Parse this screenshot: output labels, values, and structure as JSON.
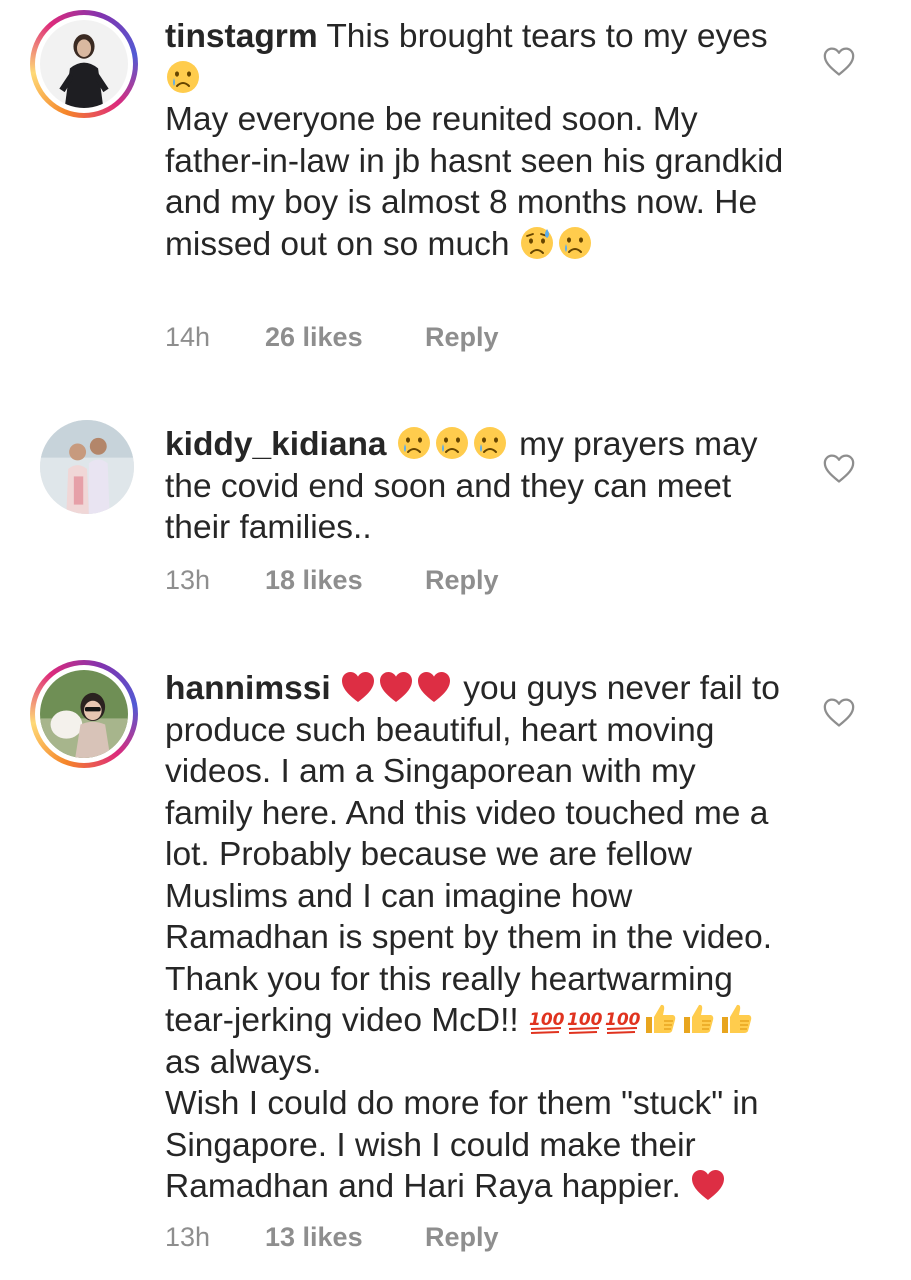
{
  "comments": [
    {
      "username": "tinstagrm",
      "parts": [
        {
          "t": " This brought tears to my eyes "
        },
        {
          "emoji": "crying-face"
        },
        {
          "t": "\nMay everyone be reunited soon. My father-in-law in jb hasnt seen his grandkid and my boy is almost 8 months now. He missed out on so much "
        },
        {
          "emoji": "sad-sweat-face"
        },
        {
          "emoji": "crying-face"
        }
      ],
      "time": "14h",
      "likes": "26 likes",
      "reply": "Reply",
      "has_story_ring": true
    },
    {
      "username": "kiddy_kidiana",
      "parts": [
        {
          "t": " "
        },
        {
          "emoji": "crying-face"
        },
        {
          "emoji": "crying-face"
        },
        {
          "emoji": "crying-face"
        },
        {
          "t": " my prayers may the covid end soon and they can meet their families.."
        }
      ],
      "time": "13h",
      "likes": "18 likes",
      "reply": "Reply",
      "has_story_ring": false
    },
    {
      "username": "hannimssi",
      "parts": [
        {
          "t": " "
        },
        {
          "emoji": "red-heart"
        },
        {
          "emoji": "red-heart"
        },
        {
          "emoji": "red-heart"
        },
        {
          "t": " you guys never fail to produce such beautiful, heart moving videos. I am a Singaporean with my family here. And this video touched me a lot. Probably because we are fellow Muslims and I can imagine how Ramadhan is spent by them in the video. Thank you for this really heartwarming tear-jerking video McD!! "
        },
        {
          "emoji": "hundred-points"
        },
        {
          "emoji": "hundred-points"
        },
        {
          "emoji": "hundred-points"
        },
        {
          "emoji": "thumbs-up"
        },
        {
          "emoji": "thumbs-up"
        },
        {
          "emoji": "thumbs-up"
        },
        {
          "t": " as always.\nWish I could do more for them \"stuck\" in Singapore. I wish I could make their Ramadhan and Hari Raya happier. "
        },
        {
          "emoji": "red-heart"
        }
      ],
      "time": "13h",
      "likes": "13 likes",
      "reply": "Reply",
      "has_story_ring": true
    }
  ],
  "icons": {
    "like": "heart-outline-icon"
  },
  "colors": {
    "text": "#262626",
    "meta": "#8e8e8e",
    "icon": "#8e8e8e"
  }
}
